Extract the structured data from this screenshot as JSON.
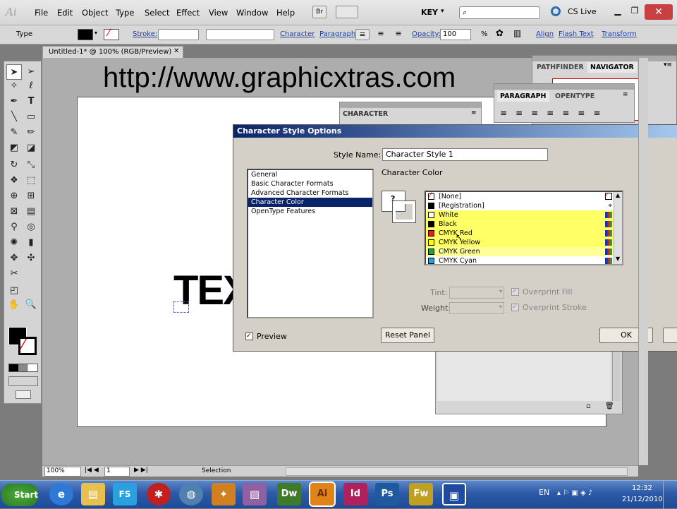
{
  "menubar": {
    "logo": "Ai",
    "items": [
      "File",
      "Edit",
      "Object",
      "Type",
      "Select",
      "Effect",
      "View",
      "Window",
      "Help"
    ],
    "br": "Br",
    "workspace": "KEY",
    "cslive": "CS Live",
    "search_icon": "search-icon"
  },
  "control": {
    "label": "Type",
    "stroke": "Stroke:",
    "character": "Character",
    "paragraph": "Paragraph:",
    "opacity_label": "Opacity:",
    "opacity_value": "100",
    "pct": "%",
    "align": "Align",
    "flash_text": "Flash Text",
    "transform": "Transform"
  },
  "document": {
    "tab": "Untitled-1* @ 100% (RGB/Preview)",
    "url_text": "http://www.graphicxtras.com",
    "art_text": "TEX"
  },
  "panels": {
    "pathfinder": "PATHFINDER",
    "navigator": "NAVIGATOR",
    "paragraph": "PARAGRAPH",
    "opentype": "OPENTYPE",
    "character": "CHARACTER"
  },
  "dialog": {
    "title": "Character Style Options",
    "style_name_label": "Style Name:",
    "style_name_value": "Character Style 1",
    "section": "Character Color",
    "categories": [
      "General",
      "Basic Character Formats",
      "Advanced Character Formats",
      "Character Color",
      "OpenType Features"
    ],
    "selected_category": "Character Color",
    "swatches": [
      {
        "name": "[None]",
        "color": "#ffffff"
      },
      {
        "name": "[Registration]",
        "color": "#000000"
      },
      {
        "name": "White",
        "color": "#ffffff"
      },
      {
        "name": "Black",
        "color": "#000000"
      },
      {
        "name": "CMYK Red",
        "color": "#e02020"
      },
      {
        "name": "CMYK Yellow",
        "color": "#ffff00"
      },
      {
        "name": "CMYK Green",
        "color": "#20a040"
      },
      {
        "name": "CMYK Cyan",
        "color": "#20a0e0"
      }
    ],
    "fill_question": "?",
    "tint_label": "Tint:",
    "weight_label": "Weight:",
    "overprint_fill": "Overprint Fill",
    "overprint_stroke": "Overprint Stroke",
    "preview_label": "Preview",
    "preview_checked": true,
    "reset_button": "Reset Panel",
    "ok_button": "OK"
  },
  "status": {
    "zoom": "100%",
    "page": "1",
    "mode": "Selection"
  },
  "taskbar": {
    "start": "Start",
    "apps": [
      "Dw",
      "Ai",
      "Id",
      "Ps",
      "Fw"
    ],
    "lang": "EN",
    "time": "12:32",
    "date": "21/12/2010"
  }
}
